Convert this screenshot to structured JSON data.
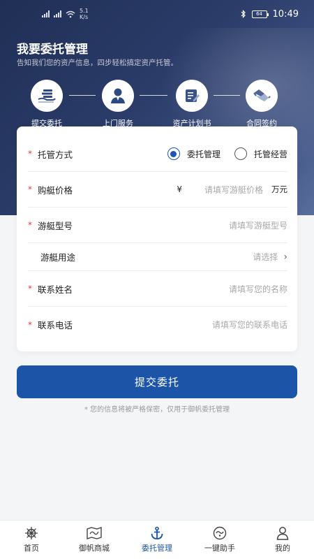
{
  "status_bar": {
    "time": "10:49",
    "net_speed": "5.1 K/s",
    "battery": "64"
  },
  "header": {
    "title": "我要委托管理",
    "subtitle": "告知我们您的资产信息，四步轻松搞定资产托管。"
  },
  "steps": [
    {
      "label": "提交委托",
      "icon": "hand-money-icon"
    },
    {
      "label": "上门服务",
      "icon": "person-icon"
    },
    {
      "label": "资产计划书",
      "icon": "document-edit-icon"
    },
    {
      "label": "合同签约",
      "icon": "handshake-icon"
    }
  ],
  "form": {
    "mode": {
      "label": "托管方式",
      "options": [
        {
          "label": "委托管理",
          "selected": true
        },
        {
          "label": "托管经营",
          "selected": false
        }
      ]
    },
    "price": {
      "label": "购艇价格",
      "currency": "¥",
      "placeholder": "请填写游艇价格",
      "unit": "万元"
    },
    "model": {
      "label": "游艇型号",
      "placeholder": "请填写游艇型号"
    },
    "usage": {
      "label": "游艇用途",
      "placeholder": "请选择"
    },
    "name": {
      "label": "联系姓名",
      "placeholder": "请填写您的名称"
    },
    "phone": {
      "label": "联系电话",
      "placeholder": "请填写您的联系电话"
    },
    "required_mark": "*"
  },
  "submit_label": "提交委托",
  "notice": "* 您的信息将被严格保密，仅用于御帆委托管理",
  "tabbar": [
    {
      "label": "首页",
      "icon": "ship-wheel-icon",
      "active": false
    },
    {
      "label": "御帆商城",
      "icon": "map-icon",
      "active": false
    },
    {
      "label": "委托管理",
      "icon": "anchor-icon",
      "active": true
    },
    {
      "label": "一键助手",
      "icon": "assistant-icon",
      "active": false
    },
    {
      "label": "我的",
      "icon": "user-icon",
      "active": false
    }
  ],
  "colors": {
    "accent": "#1c55a8",
    "hero": "#2b3c69",
    "required": "#e23b3b"
  }
}
